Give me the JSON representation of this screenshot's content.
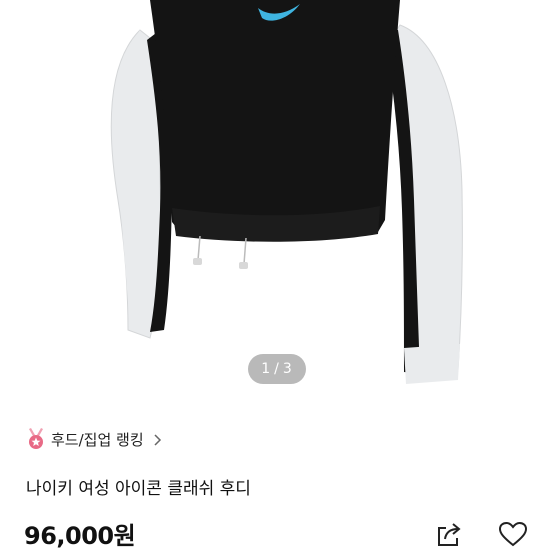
{
  "gallery": {
    "current_page": "1",
    "total_pages": "3",
    "separator": "/"
  },
  "ranking": {
    "label": "후드/집업 랭킹",
    "icon": "medal-icon"
  },
  "product": {
    "title": "나이키 여성 아이콘 클래쉬 후디",
    "price": "96,000원"
  },
  "actions": {
    "share_icon": "share-icon",
    "like_icon": "heart-icon"
  },
  "colors": {
    "hoodie_body": "#111111",
    "sleeves": "#e8eaec",
    "logo": "#3fb4e0",
    "medal_pink": "#e86a86"
  }
}
